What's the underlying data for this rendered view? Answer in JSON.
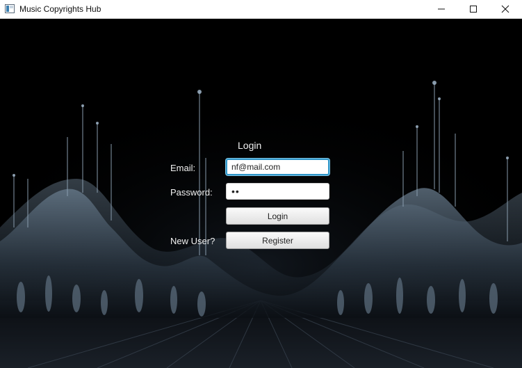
{
  "window": {
    "title": "Music Copyrights Hub",
    "controls": {
      "minimize_icon": "minimize-icon",
      "maximize_icon": "maximize-icon",
      "close_icon": "close-icon"
    }
  },
  "login": {
    "title": "Login",
    "email_label": "Email:",
    "email_value": "nf@mail.com",
    "password_label": "Password:",
    "password_value": "••",
    "login_button": "Login",
    "new_user_label": "New User?",
    "register_button": "Register"
  },
  "colors": {
    "background": "#000000",
    "text": "#f2f2f2",
    "focus_border": "#2f96c9",
    "wave": "#9fb4c8"
  }
}
